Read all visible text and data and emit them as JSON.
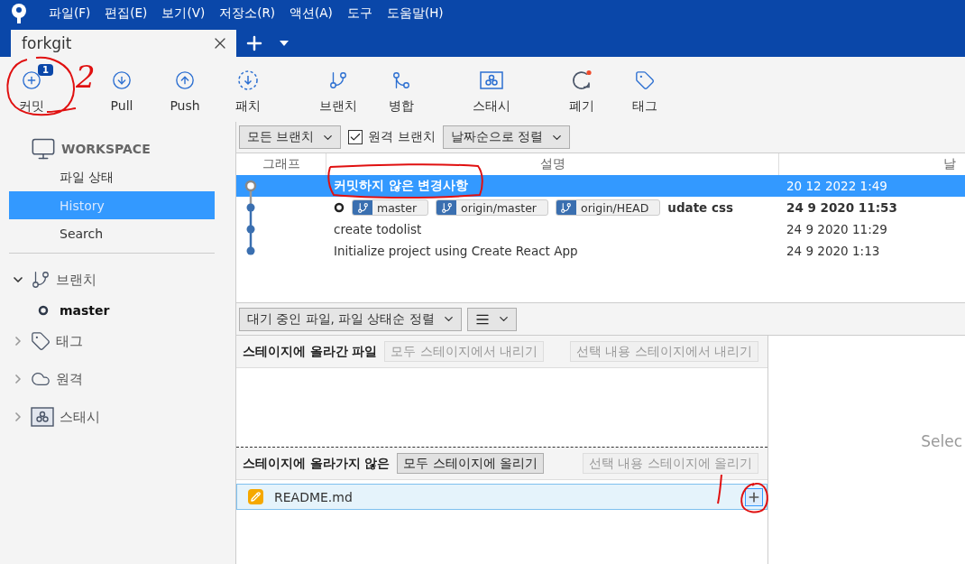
{
  "menu": [
    "파일(F)",
    "편집(E)",
    "보기(V)",
    "저장소(R)",
    "액션(A)",
    "도구",
    "도움말(H)"
  ],
  "tabs": [
    {
      "label": "forkgit",
      "selected": true
    }
  ],
  "toolbar": [
    {
      "label": "커밋",
      "kind": "commit",
      "badge": "1"
    },
    {
      "label": "Pull",
      "kind": "pull"
    },
    {
      "label": "Push",
      "kind": "push"
    },
    {
      "label": "패치",
      "kind": "fetch"
    },
    {
      "label": "브랜치",
      "kind": "branch"
    },
    {
      "label": "병합",
      "kind": "merge"
    },
    {
      "label": "스태시",
      "kind": "stash"
    },
    {
      "label": "폐기",
      "kind": "discard"
    },
    {
      "label": "태그",
      "kind": "tag"
    }
  ],
  "sidebar": {
    "workspace": {
      "title": "WORKSPACE",
      "items": [
        {
          "label": "파일 상태",
          "selected": false
        },
        {
          "label": "History",
          "selected": true
        },
        {
          "label": "Search",
          "selected": false
        }
      ]
    },
    "sections": [
      {
        "label": "브랜치",
        "kind": "branch",
        "expanded": true,
        "children": [
          {
            "label": "master",
            "current": true
          }
        ]
      },
      {
        "label": "태그",
        "kind": "tag",
        "expanded": false
      },
      {
        "label": "원격",
        "kind": "remote",
        "expanded": false
      },
      {
        "label": "스태시",
        "kind": "stash",
        "expanded": false
      }
    ]
  },
  "history": {
    "filters": [
      {
        "kind": "dropdown",
        "label": "모든 브랜치"
      },
      {
        "kind": "checkbox",
        "label": "원격 브랜치",
        "checked": true
      },
      {
        "kind": "dropdown",
        "label": "날짜순으로 정렬"
      }
    ],
    "columns": [
      "그래프",
      "설명",
      "날"
    ],
    "rows": [
      {
        "kind": "uncommitted",
        "description": "커밋하지 않은 변경사항",
        "date": "20 12 2022 1:49",
        "selected": true
      },
      {
        "kind": "commit",
        "head": true,
        "refs": [
          "master",
          "origin/master",
          "origin/HEAD"
        ],
        "description": "udate css",
        "date": "24 9 2020 11:53",
        "selected": false
      },
      {
        "kind": "commit",
        "head": false,
        "description": "create todolist",
        "date": "24 9 2020 11:29",
        "selected": false
      },
      {
        "kind": "commit",
        "head": false,
        "description": "Initialize project using Create React App",
        "date": "24 9 2020 1:13",
        "selected": false
      }
    ]
  },
  "files_toolbar": {
    "sort": "대기 중인 파일, 파일 상태순 정렬"
  },
  "staged": {
    "title": "스테이지에 올라간 파일",
    "buttons": [
      {
        "label": "모두 스테이지에서 내리기",
        "disabled": true
      },
      {
        "label": "선택 내용 스테이지에서 내리기",
        "disabled": true
      }
    ]
  },
  "unstaged": {
    "title": "스테이지에 올라가지 않은",
    "buttons": [
      {
        "label": "모두 스테이지에 올리기",
        "disabled": false
      },
      {
        "label": "선택 내용 스테이지에 올리기",
        "disabled": true
      }
    ],
    "files": [
      {
        "name": "README.md",
        "kind": "modified",
        "selected": true
      }
    ]
  },
  "diff": {
    "message": "Selec"
  },
  "annotation_note": "2"
}
